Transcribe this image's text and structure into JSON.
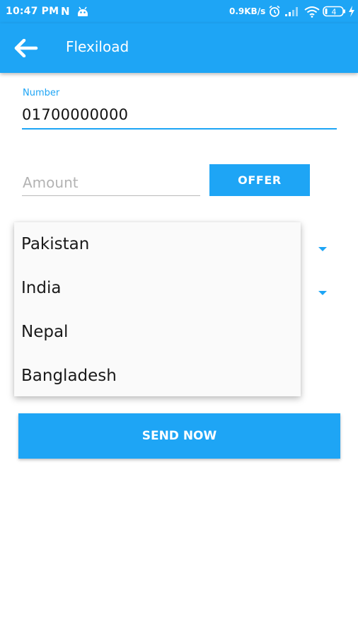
{
  "status_bar": {
    "time": "10:47 PM",
    "notification_letter": "N",
    "network_speed": "0.9KB/s",
    "battery_level": "4"
  },
  "app_bar": {
    "title": "Flexiload",
    "back_icon": "arrow-left-icon"
  },
  "form": {
    "number_label": "Number",
    "number_value": "01700000000",
    "amount_placeholder": "Amount",
    "offer_button_label": "OFFER"
  },
  "dropdown": {
    "options": [
      "Pakistan",
      "India",
      "Nepal",
      "Bangladesh"
    ]
  },
  "send_button_label": "SEND NOW",
  "colors": {
    "accent": "#1ea5f5",
    "background": "#ffffff",
    "menu_background": "#fafafa",
    "placeholder": "#b3b3b3"
  }
}
